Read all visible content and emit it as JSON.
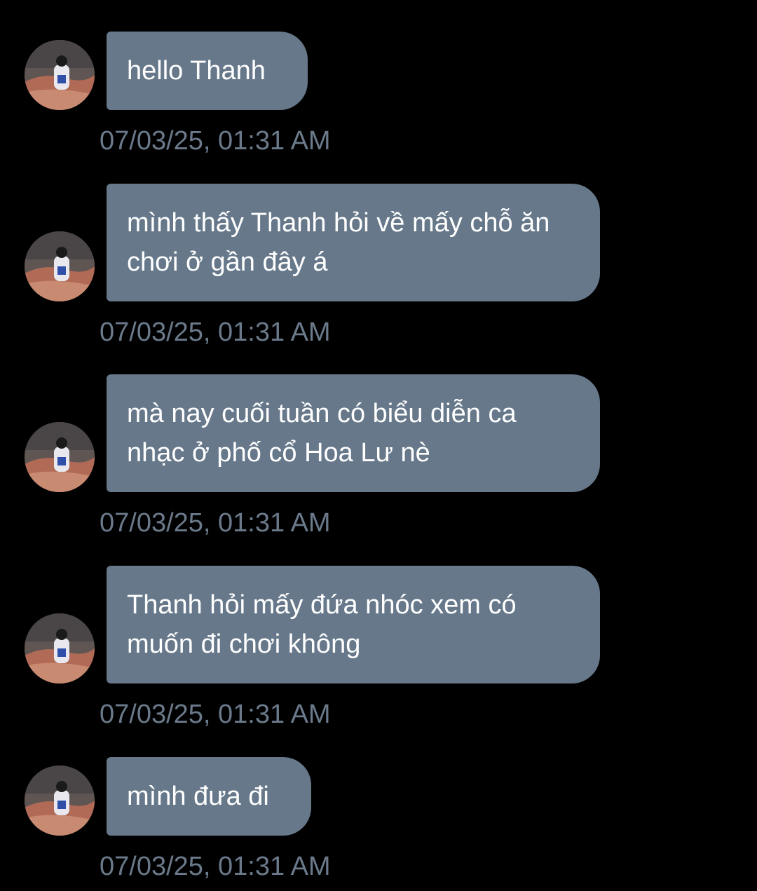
{
  "chat": {
    "messages": [
      {
        "avatar_icon": "user-avatar-photo",
        "text": "hello Thanh",
        "time": "07/03/25, 01:31 AM"
      },
      {
        "avatar_icon": "user-avatar-photo",
        "text": "mình thấy Thanh hỏi về mấy chỗ ăn\nchơi ở gần đây á",
        "time": "07/03/25, 01:31 AM"
      },
      {
        "avatar_icon": "user-avatar-photo",
        "text": "mà nay cuối tuần có biểu diễn ca\nnhạc ở phố cổ Hoa Lư nè",
        "time": "07/03/25, 01:31 AM"
      },
      {
        "avatar_icon": "user-avatar-photo",
        "text": "Thanh hỏi mấy đứa nhóc xem có\nmuốn đi chơi không",
        "time": "07/03/25, 01:31 AM"
      },
      {
        "avatar_icon": "user-avatar-photo",
        "text": "mình đưa đi",
        "time": "07/03/25, 01:31 AM"
      }
    ]
  },
  "colors": {
    "background": "#000000",
    "bubble": "#66788a",
    "bubble_text": "#ffffff",
    "timestamp": "#6b7a8b"
  }
}
